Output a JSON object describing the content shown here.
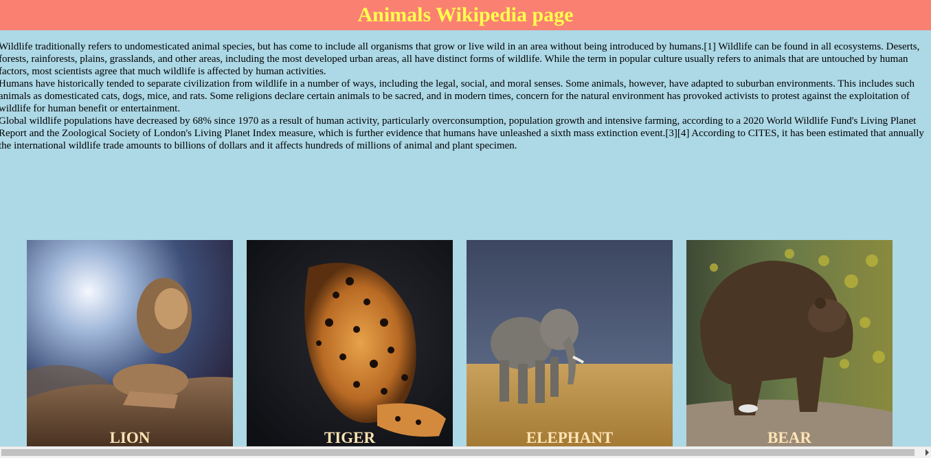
{
  "header": {
    "title": "Animals Wikipedia page"
  },
  "article": {
    "paragraphs": [
      "Wildlife traditionally refers to undomesticated animal species, but has come to include all organisms that grow or live wild in an area without being introduced by humans.[1] Wildlife can be found in all ecosystems. Deserts, forests, rainforests, plains, grasslands, and other areas, including the most developed urban areas, all have distinct forms of wildlife. While the term in popular culture usually refers to animals that are untouched by human factors, most scientists agree that much wildlife is affected by human activities.",
      "Humans have historically tended to separate civilization from wildlife in a number of ways, including the legal, social, and moral senses. Some animals, however, have adapted to suburban environments. This includes such animals as domesticated cats, dogs, mice, and rats. Some religions declare certain animals to be sacred, and in modern times, concern for the natural environment has provoked activists to protest against the exploitation of wildlife for human benefit or entertainment.",
      "Global wildlife populations have decreased by 68% since 1970 as a result of human activity, particularly overconsumption, population growth and intensive farming, according to a 2020 World Wildlife Fund's Living Planet Report and the Zoological Society of London's Living Planet Index measure, which is further evidence that humans have unleashed a sixth mass extinction event.[3][4] According to CITES, it has been estimated that annually the international wildlife trade amounts to billions of dollars and it affects hundreds of millions of animal and plant specimen."
    ]
  },
  "gallery": {
    "cards": [
      {
        "label": "LION",
        "image": "lion-photo"
      },
      {
        "label": "TIGER",
        "image": "leopard-photo"
      },
      {
        "label": "ELEPHANT",
        "image": "elephant-photo"
      },
      {
        "label": "BEAR",
        "image": "bear-photo"
      }
    ]
  },
  "colors": {
    "header_bg": "#fa8072",
    "header_text": "#ffff4d",
    "page_bg": "#add8e6",
    "caption_text": "#ffe4b5"
  }
}
